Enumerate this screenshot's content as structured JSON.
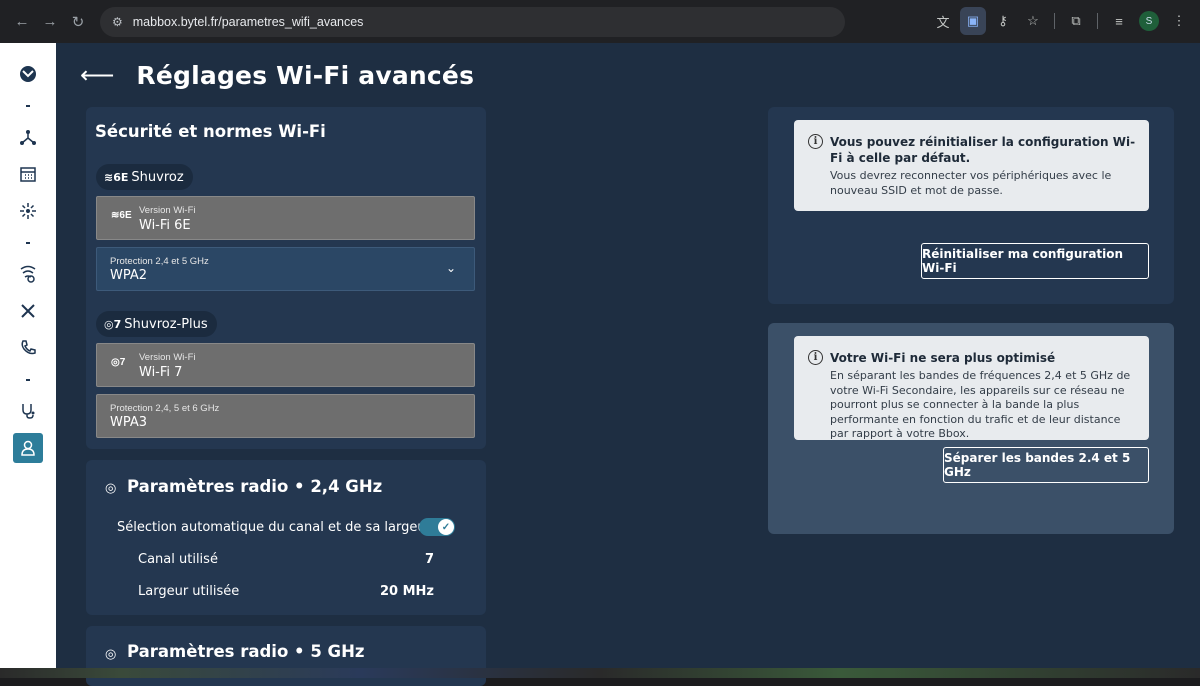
{
  "browser": {
    "url": "mabbox.bytel.fr/parametres_wifi_avances",
    "profile_initial": "S"
  },
  "page": {
    "title": "Réglages Wi-Fi avancés"
  },
  "security": {
    "title": "Sécurité et normes Wi-Fi",
    "networks": [
      {
        "name": "Shuvroz",
        "icon": "wifi-6e-icon",
        "version_label": "Version Wi-Fi",
        "version_value": "Wi-Fi 6E",
        "protection_label": "Protection 2,4 et 5 GHz",
        "protection_value": "WPA2"
      },
      {
        "name": "Shuvroz-Plus",
        "icon": "wifi-7-icon",
        "version_label": "Version Wi-Fi",
        "version_value": "Wi-Fi 7",
        "protection_label": "Protection 2,4, 5 et 6 GHz",
        "protection_value": "WPA3"
      }
    ]
  },
  "radio24": {
    "title": "Paramètres radio • 2,4 GHz",
    "auto_label": "Sélection automatique du canal et de sa largeur",
    "auto_enabled": true,
    "channel_label": "Canal utilisé",
    "channel_value": "7",
    "width_label": "Largeur utilisée",
    "width_value": "20 MHz"
  },
  "radio5": {
    "title": "Paramètres radio • 5 GHz"
  },
  "reset_card": {
    "info_title": "Vous pouvez réinitialiser la configuration Wi-Fi à celle par défaut.",
    "info_text": "Vous devrez reconnecter vos périphériques avec le nouveau SSID et mot de passe.",
    "button": "Réinitialiser ma configuration Wi-Fi"
  },
  "split_card": {
    "info_title": "Votre Wi-Fi ne sera plus optimisé",
    "info_text": "En séparant les bandes de fréquences 2,4 et 5 GHz de votre Wi-Fi Secondaire, les appareils sur ce réseau ne pourront plus se connecter à la bande la plus performante en fonction du trafic et de leur distance par rapport à votre Bbox.",
    "button": "Séparer les bandes 2.4 et 5 GHz"
  },
  "colors": {
    "background": "#1e2e42",
    "card": "#243750",
    "accent": "#2f7c98",
    "sidebar_active": "#2d7d9a"
  }
}
